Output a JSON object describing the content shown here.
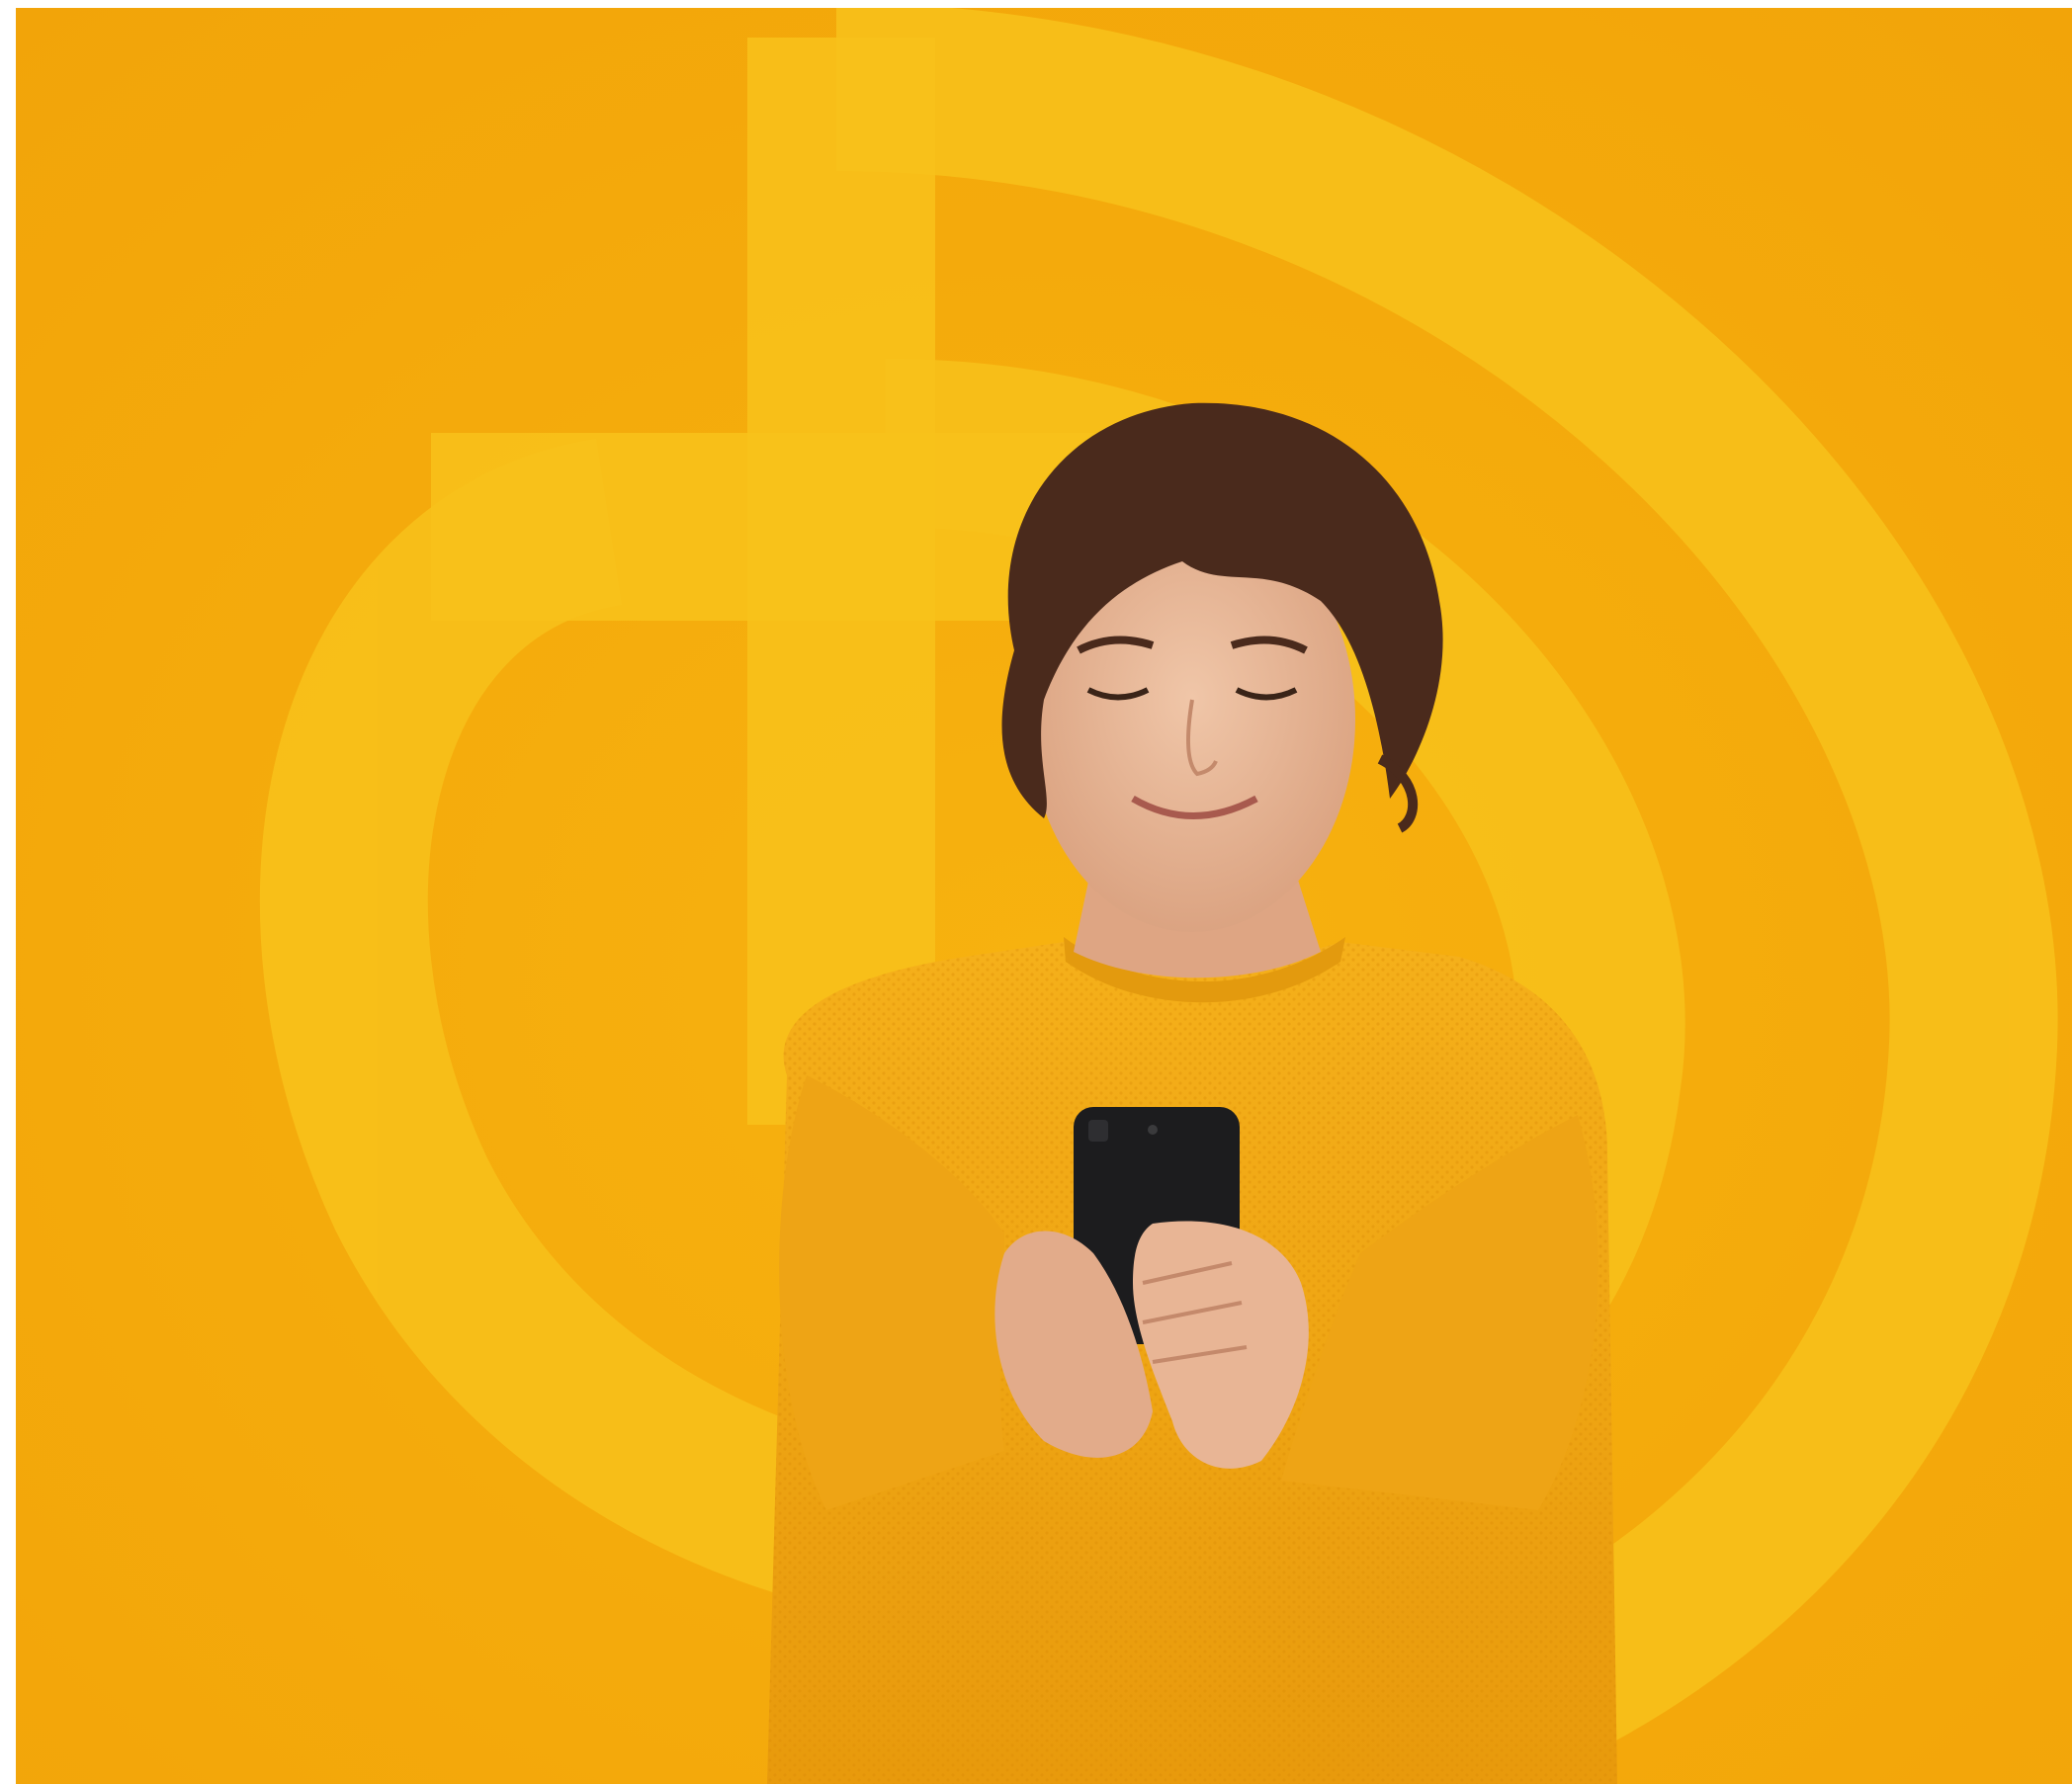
{
  "image": {
    "kind": "photograph",
    "colors": {
      "background": "#f5ab0d",
      "emblem": "#f8c21b",
      "sweater": "#f0a612",
      "sweater_shadow": "#d98a06",
      "skin": "#e8b89a",
      "hair": "#4a2a1c",
      "phone": "#1c1c1e",
      "frame": "#ffffff"
    },
    "icons": [
      "emblem-logo-icon",
      "smartphone-icon"
    ]
  }
}
